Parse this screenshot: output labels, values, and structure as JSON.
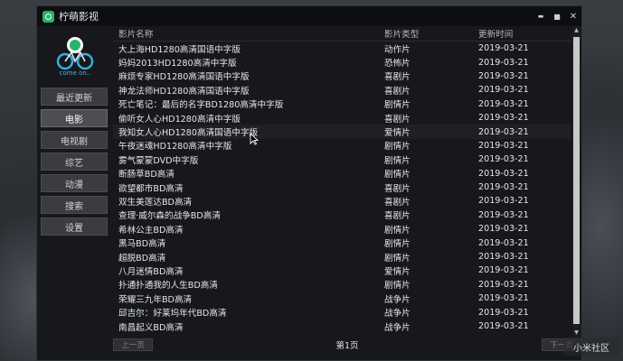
{
  "app": {
    "title": "柠萌影视",
    "logo_text": "come on.."
  },
  "window_controls": {
    "minimize": "▬",
    "maximize": "■",
    "close": "✕"
  },
  "sidebar": {
    "items": [
      {
        "label": "最近更新",
        "active": false
      },
      {
        "label": "电影",
        "active": true
      },
      {
        "label": "电视剧",
        "active": false
      },
      {
        "label": "综艺",
        "active": false
      },
      {
        "label": "动漫",
        "active": false
      },
      {
        "label": "搜索",
        "active": false
      },
      {
        "label": "设置",
        "active": false
      }
    ]
  },
  "table": {
    "headers": {
      "name": "影片名称",
      "type": "影片类型",
      "date": "更新时间"
    },
    "rows": [
      {
        "name": "大上海HD1280高清国语中字版",
        "type": "动作片",
        "date": "2019-03-21"
      },
      {
        "name": "妈妈2013HD1280高清中字版",
        "type": "恐怖片",
        "date": "2019-03-21"
      },
      {
        "name": "麻烦专家HD1280高清国语中字版",
        "type": "喜剧片",
        "date": "2019-03-21"
      },
      {
        "name": "神龙法师HD1280高清国语中字版",
        "type": "喜剧片",
        "date": "2019-03-21"
      },
      {
        "name": "死亡笔记：最后的名字BD1280高清中字版",
        "type": "剧情片",
        "date": "2019-03-21"
      },
      {
        "name": "偷听女人心HD1280高清中字版",
        "type": "喜剧片",
        "date": "2019-03-21"
      },
      {
        "name": "我知女人心HD1280高清国语中字版",
        "type": "爱情片",
        "date": "2019-03-21"
      },
      {
        "name": "午夜迷魂HD1280高清中字版",
        "type": "剧情片",
        "date": "2019-03-21"
      },
      {
        "name": "雾气蒙蒙DVD中字版",
        "type": "剧情片",
        "date": "2019-03-21"
      },
      {
        "name": "断肠草BD高清",
        "type": "剧情片",
        "date": "2019-03-21"
      },
      {
        "name": "欲望都市BD高清",
        "type": "喜剧片",
        "date": "2019-03-21"
      },
      {
        "name": "双生美莲达BD高清",
        "type": "喜剧片",
        "date": "2019-03-21"
      },
      {
        "name": "查理·威尔森的战争BD高清",
        "type": "喜剧片",
        "date": "2019-03-21"
      },
      {
        "name": "希林公主BD高清",
        "type": "剧情片",
        "date": "2019-03-21"
      },
      {
        "name": "黑马BD高清",
        "type": "剧情片",
        "date": "2019-03-21"
      },
      {
        "name": "超脱BD高清",
        "type": "剧情片",
        "date": "2019-03-21"
      },
      {
        "name": "八月迷情BD高清",
        "type": "爱情片",
        "date": "2019-03-21"
      },
      {
        "name": "扑通扑通我的人生BD高清",
        "type": "剧情片",
        "date": "2019-03-21"
      },
      {
        "name": "荣耀三九年BD高清",
        "type": "战争片",
        "date": "2019-03-21"
      },
      {
        "name": "邱吉尔：好莱坞年代BD高清",
        "type": "战争片",
        "date": "2019-03-21"
      },
      {
        "name": "南昌起义BD高清",
        "type": "战争片",
        "date": "2019-03-21"
      }
    ]
  },
  "scrollbar": {
    "up": "▲",
    "down": "▼"
  },
  "pagination": {
    "prev": "上一页",
    "page_label": "第1页",
    "next": "下一页"
  },
  "watermark": "小米社区",
  "colors": {
    "accent": "#27b36a",
    "logo_text": "#4fb5e8",
    "background": "#16181b"
  }
}
